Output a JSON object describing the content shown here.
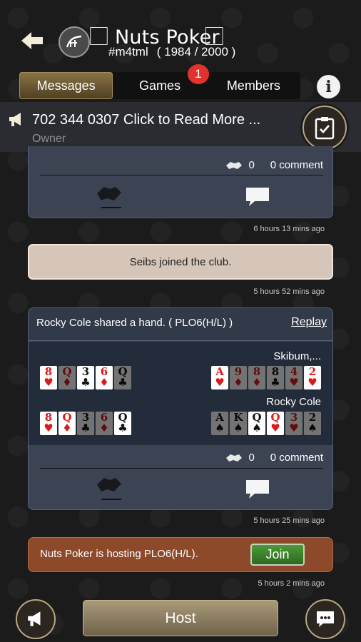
{
  "header": {
    "title": "\u0000 Nuts Poker \u0000",
    "title_display": "⃞ Nuts Poker ⃞",
    "club_id": "#m4tml",
    "member_count": "( 1984 / 2000 )"
  },
  "tabs": [
    {
      "label": "Messages",
      "active": true
    },
    {
      "label": "Games",
      "active": false,
      "badge": "1"
    },
    {
      "label": "Members",
      "active": false
    }
  ],
  "info_label": "i",
  "announcement": {
    "text": "702 344 0307 Click to Read More ...",
    "role": "Owner"
  },
  "feed": {
    "card1": {
      "likes": "0",
      "comments": "0 comment",
      "time": "6 hours 13 mins ago"
    },
    "joined": {
      "text": "Seibs joined the club.",
      "time": "5 hours 52 mins ago"
    },
    "hand": {
      "title": "Rocky Cole shared a hand. ( PLO6(H/L) )",
      "replay": "Replay",
      "players": [
        {
          "name": "Skibum,...",
          "left_cards": [
            {
              "rank": "8",
              "suit": "♥",
              "color": "red",
              "dim": false
            },
            {
              "rank": "Q",
              "suit": "♦",
              "color": "red",
              "dim": true
            },
            {
              "rank": "3",
              "suit": "♣",
              "color": "black",
              "dim": false
            },
            {
              "rank": "6",
              "suit": "♦",
              "color": "red",
              "dim": false
            },
            {
              "rank": "Q",
              "suit": "♣",
              "color": "black",
              "dim": true
            }
          ],
          "right_cards": [
            {
              "rank": "A",
              "suit": "♥",
              "color": "red",
              "dim": false
            },
            {
              "rank": "9",
              "suit": "♦",
              "color": "red",
              "dim": true
            },
            {
              "rank": "8",
              "suit": "♦",
              "color": "red",
              "dim": true
            },
            {
              "rank": "8",
              "suit": "♣",
              "color": "black",
              "dim": true
            },
            {
              "rank": "4",
              "suit": "♥",
              "color": "red",
              "dim": true
            },
            {
              "rank": "2",
              "suit": "♥",
              "color": "red",
              "dim": false
            }
          ]
        },
        {
          "name": "Rocky Cole",
          "left_cards": [
            {
              "rank": "8",
              "suit": "♥",
              "color": "red",
              "dim": false
            },
            {
              "rank": "Q",
              "suit": "♦",
              "color": "red",
              "dim": false
            },
            {
              "rank": "3",
              "suit": "♣",
              "color": "black",
              "dim": true
            },
            {
              "rank": "6",
              "suit": "♦",
              "color": "red",
              "dim": true
            },
            {
              "rank": "Q",
              "suit": "♣",
              "color": "black",
              "dim": false
            }
          ],
          "right_cards": [
            {
              "rank": "A",
              "suit": "♠",
              "color": "black",
              "dim": true
            },
            {
              "rank": "K",
              "suit": "♠",
              "color": "black",
              "dim": true
            },
            {
              "rank": "Q",
              "suit": "♠",
              "color": "black",
              "dim": false
            },
            {
              "rank": "Q",
              "suit": "♥",
              "color": "red",
              "dim": false
            },
            {
              "rank": "3",
              "suit": "♥",
              "color": "red",
              "dim": true
            },
            {
              "rank": "2",
              "suit": "♠",
              "color": "black",
              "dim": true
            }
          ]
        }
      ],
      "likes": "0",
      "comments": "0 comment",
      "time": "5 hours 25 mins ago"
    },
    "hosting": {
      "text": "Nuts Poker is hosting PLO6(H/L).",
      "join": "Join",
      "time": "5 hours 2 mins ago"
    }
  },
  "bottom": {
    "host_label": "Host"
  },
  "icons": [
    "back-arrow-icon",
    "club-logo-icon",
    "megaphone-icon",
    "clipboard-check-icon",
    "handshake-icon",
    "comment-bubble-icon",
    "chat-icon"
  ],
  "colors": {
    "active_tab": "#8a7448",
    "badge": "#e0332d",
    "card_bg": "#3c4453",
    "joined_bg": "#d6c6b9",
    "hosting_bg": "#8c4a2b",
    "join_btn": "#4d9a39",
    "host_btn": "#a99a7a"
  }
}
